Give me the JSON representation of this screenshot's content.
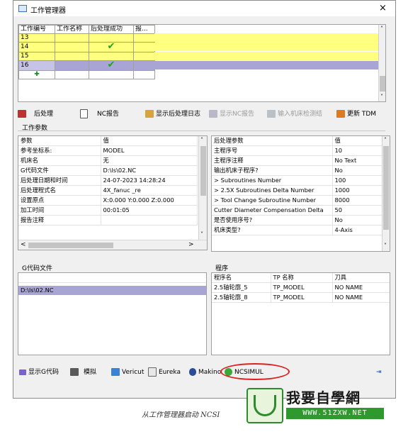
{
  "window": {
    "title": "工作管理器",
    "close_glyph": "×"
  },
  "jobs": {
    "columns": [
      "工作编号",
      "工作名称",
      "后处理成功",
      "报..."
    ],
    "rows": [
      {
        "id": "13",
        "name": "",
        "success": "",
        "report": ""
      },
      {
        "id": "14",
        "name": "",
        "success": "✔",
        "report": ""
      },
      {
        "id": "15",
        "name": "",
        "success": "",
        "report": ""
      },
      {
        "id": "16",
        "name": "",
        "success": "✔",
        "report": ""
      }
    ],
    "add_glyph": "✚"
  },
  "toolbar": {
    "postprocess": "后处理",
    "nc_report": "NC报告",
    "show_post_log": "显示后处理日志",
    "show_nc_report": "显示NC报告",
    "machine_check": "输入机床检测结",
    "update_tdm": "更新 TDM"
  },
  "work_params": {
    "section_title": "工作参数",
    "headers": [
      "参数",
      "值"
    ],
    "rows": [
      [
        "参考坐标系:",
        "MODEL"
      ],
      [
        "机床名",
        "无"
      ],
      [
        "G代码文件",
        "D:\\ls\\02.NC"
      ],
      [
        "后处理日期和时间",
        "24-07-2023 14:28:24"
      ],
      [
        "后处理程式名",
        "4X_fanuc _re"
      ],
      [
        "设置原点",
        "X:0.000 Y:0.000 Z:0.000"
      ],
      [
        "加工时间",
        "00:01:05"
      ],
      [
        "报告注释",
        ""
      ]
    ]
  },
  "post_params": {
    "headers": [
      "后处理参数",
      "值"
    ],
    "rows": [
      [
        "主程序号",
        "10"
      ],
      [
        "主程序注释",
        "No Text"
      ],
      [
        "输出机床子程序?",
        "No"
      ],
      [
        "> Subroutines Number",
        "100"
      ],
      [
        "> 2.5X Subroutines Delta Number",
        "1000"
      ],
      [
        "> Tool Change Subroutine Number",
        "8000"
      ],
      [
        "Cutter Diameter Compensation Delta",
        "50"
      ],
      [
        "是否使用序号?",
        "No"
      ],
      [
        "机床类型?",
        "4-Axis"
      ]
    ]
  },
  "gcode_files": {
    "section_title": "G代码文件",
    "rows": [
      "D:\\ls\\02.NC"
    ]
  },
  "programs": {
    "section_title": "程序",
    "headers": [
      "程序名",
      "TP 名称",
      "刀具"
    ],
    "rows": [
      [
        "2.5轴轮廓_5",
        "TP_MODEL",
        "NO NAME"
      ],
      [
        "2.5轴轮廓_8",
        "TP_MODEL",
        "NO NAME"
      ]
    ]
  },
  "bottom_bar": {
    "show_gcode": "显示G代码",
    "simulate": "模拟",
    "vericut": "Vericut",
    "eureka": "Eureka",
    "makino": "Makino",
    "ncsimul": "NCSIMUL"
  },
  "caption": "从工作管理器启动 NCSI",
  "watermark": {
    "title": "我要自學網",
    "url": "WWW.51ZXW.NET"
  },
  "colors": {
    "yellow_row": "#ffff80",
    "selected_row": "#a8a4d4",
    "highlight_circle": "#e02020"
  }
}
